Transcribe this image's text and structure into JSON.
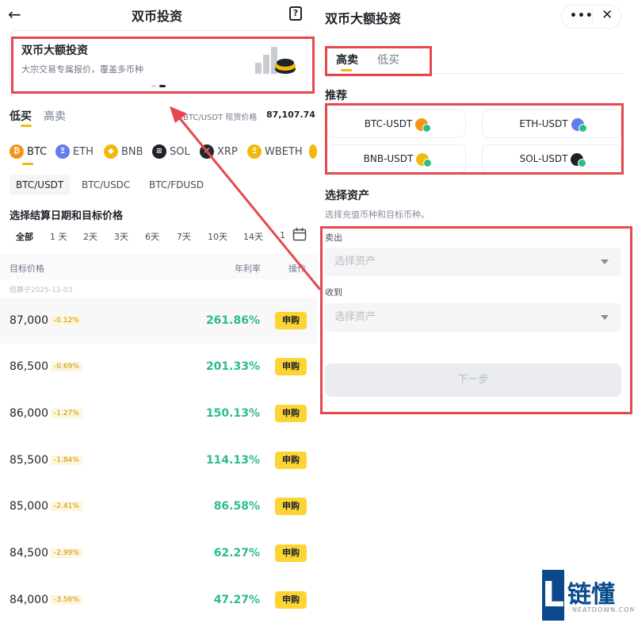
{
  "left": {
    "header": {
      "title": "双币投资"
    },
    "banner": {
      "title": "双币大额投资",
      "subtitle": "大宗交易专属报价，覆盖多币种"
    },
    "tabs": [
      "低买",
      "高卖"
    ],
    "price_label": "BTC/USDT 现货价格",
    "price_value": "87,107.74",
    "coins": [
      {
        "label": "BTC",
        "glyph": "₿",
        "color": "#f7931a"
      },
      {
        "label": "ETH",
        "glyph": "Ξ",
        "color": "#627eea"
      },
      {
        "label": "BNB",
        "glyph": "◆",
        "color": "#f0b90b"
      },
      {
        "label": "SOL",
        "glyph": "≡",
        "color": "#1e2329"
      },
      {
        "label": "XRP",
        "glyph": "✕",
        "color": "#23292f"
      },
      {
        "label": "WBETH",
        "glyph": "Ξ",
        "color": "#f0b90b"
      }
    ],
    "pairs": [
      "BTC/USDT",
      "BTC/USDC",
      "BTC/FDUSD"
    ],
    "settle_title": "选择结算日期和目标价格",
    "days": [
      "全部",
      "1 天",
      "2天",
      "3天",
      "6天",
      "7天",
      "10天",
      "14天",
      "1"
    ],
    "table_headers": {
      "target": "目标价格",
      "rate": "年利率",
      "action": "操作"
    },
    "settle_date": "结算于2025-12-03",
    "rows": [
      {
        "price": "87,000",
        "pct": "-0.12%",
        "rate": "261.86%",
        "btn": "申购"
      },
      {
        "price": "86,500",
        "pct": "-0.69%",
        "rate": "201.33%",
        "btn": "申购"
      },
      {
        "price": "86,000",
        "pct": "-1.27%",
        "rate": "150.13%",
        "btn": "申购"
      },
      {
        "price": "85,500",
        "pct": "-1.84%",
        "rate": "114.13%",
        "btn": "申购"
      },
      {
        "price": "85,000",
        "pct": "-2.41%",
        "rate": "86.58%",
        "btn": "申购"
      },
      {
        "price": "84,500",
        "pct": "-2.99%",
        "rate": "62.27%",
        "btn": "申购"
      },
      {
        "price": "84,000",
        "pct": "-3.56%",
        "rate": "47.27%",
        "btn": "申购"
      }
    ]
  },
  "right": {
    "header": {
      "title": "双币大额投资"
    },
    "tabs": [
      "高卖",
      "低买"
    ],
    "recommend_title": "推荐",
    "recommend": [
      {
        "label": "BTC-USDT",
        "color": "#f7931a"
      },
      {
        "label": "ETH-USDT",
        "color": "#627eea"
      },
      {
        "label": "BNB-USDT",
        "color": "#f0b90b"
      },
      {
        "label": "SOL-USDT",
        "color": "#1e2329"
      }
    ],
    "assets_title": "选择资产",
    "assets_sub": "选择充值币种和目标币种。",
    "sell_label": "卖出",
    "sell_placeholder": "选择资产",
    "receive_label": "收到",
    "receive_placeholder": "选择资产",
    "next_btn": "下一步"
  },
  "watermark": {
    "letter": "L",
    "text": "链懂",
    "sub": "NEATDOWN.COM"
  },
  "colors": {
    "accent": "#f0b90b",
    "positive": "#2ebd85",
    "annotation": "#e5484d"
  }
}
